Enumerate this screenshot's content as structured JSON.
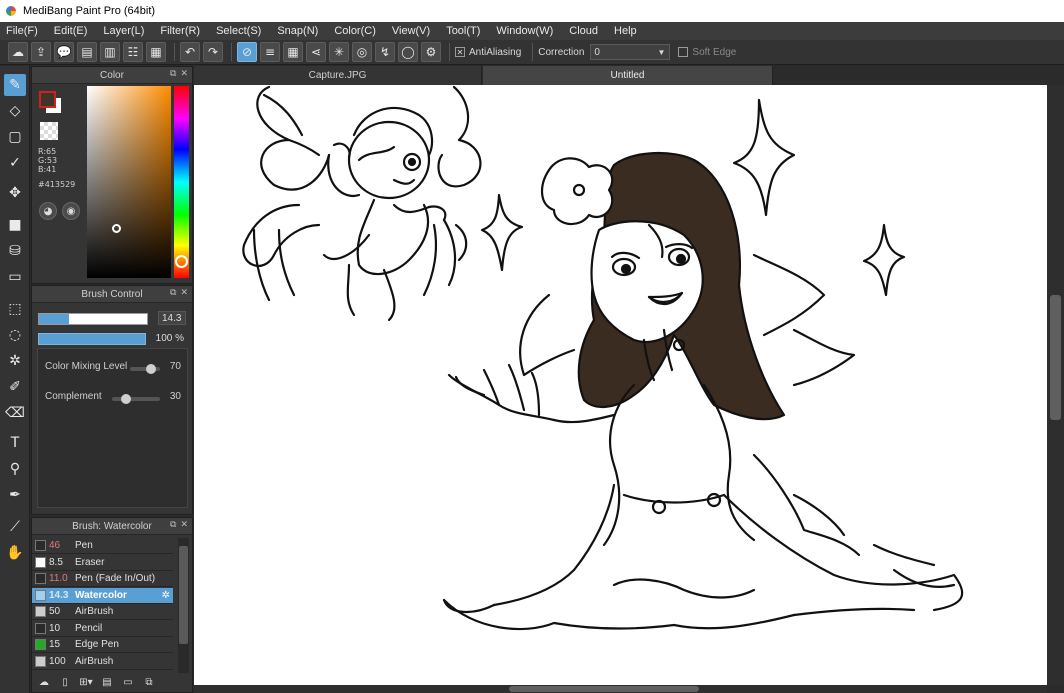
{
  "window": {
    "title": "MediBang Paint Pro (64bit)"
  },
  "menu": [
    "File(F)",
    "Edit(E)",
    "Layer(L)",
    "Filter(R)",
    "Select(S)",
    "Snap(N)",
    "Color(C)",
    "View(V)",
    "Tool(T)",
    "Window(W)",
    "Cloud",
    "Help"
  ],
  "toolbar": {
    "antialiasing_label": "AntiAliasing",
    "antialiasing_checked": true,
    "correction_label": "Correction",
    "correction_value": "0",
    "soft_edge_label": "Soft Edge",
    "soft_edge_checked": false
  },
  "tabs": [
    {
      "label": "Capture.JPG",
      "active": false
    },
    {
      "label": "Untitled",
      "active": true
    }
  ],
  "color_panel": {
    "title": "Color",
    "r": "R:65",
    "g": "G:53",
    "b": "B:41",
    "hex": "#413529",
    "foreground": "#413529",
    "background": "#ffffff"
  },
  "brush_control": {
    "title": "Brush Control",
    "size_value": "14.3",
    "size_fraction": 0.28,
    "opacity_value": "100 %",
    "opacity_fraction": 1.0,
    "color_mixing_label": "Color Mixing Level",
    "color_mixing_value": "70",
    "color_mixing_fraction": 0.7,
    "complement_label": "Complement",
    "complement_value": "30",
    "complement_fraction": 0.3
  },
  "brush_list": {
    "title": "Brush: Watercolor",
    "items": [
      {
        "size": "46",
        "name": "Pen",
        "swatch": "#2a2a2a",
        "active": false,
        "size_color": "#e07a7a"
      },
      {
        "size": "8.5",
        "name": "Eraser",
        "swatch": "#ffffff",
        "active": false,
        "size_color": "#e0e0e0"
      },
      {
        "size": "11.0",
        "name": "Pen (Fade In/Out)",
        "swatch": "#2a2a2a",
        "active": false,
        "size_color": "#e07a7a"
      },
      {
        "size": "14.3",
        "name": "Watercolor",
        "swatch": "#9fd0f0",
        "active": true,
        "size_color": "#cfe6f7"
      },
      {
        "size": "50",
        "name": "AirBrush",
        "swatch": "#cccccc",
        "active": false,
        "size_color": "#e0e0e0"
      },
      {
        "size": "10",
        "name": "Pencil",
        "swatch": "#2a2a2a",
        "active": false,
        "size_color": "#e0e0e0"
      },
      {
        "size": "15",
        "name": "Edge Pen",
        "swatch": "#22aa22",
        "active": false,
        "size_color": "#e0e0e0"
      },
      {
        "size": "100",
        "name": "AirBrush",
        "swatch": "#cccccc",
        "active": false,
        "size_color": "#e0e0e0"
      }
    ]
  },
  "colors": {
    "accent": "#5a9fd4",
    "panel_bg": "#353535",
    "hair": "#3b2c22",
    "skin_highlight": "#f6e9dd"
  }
}
